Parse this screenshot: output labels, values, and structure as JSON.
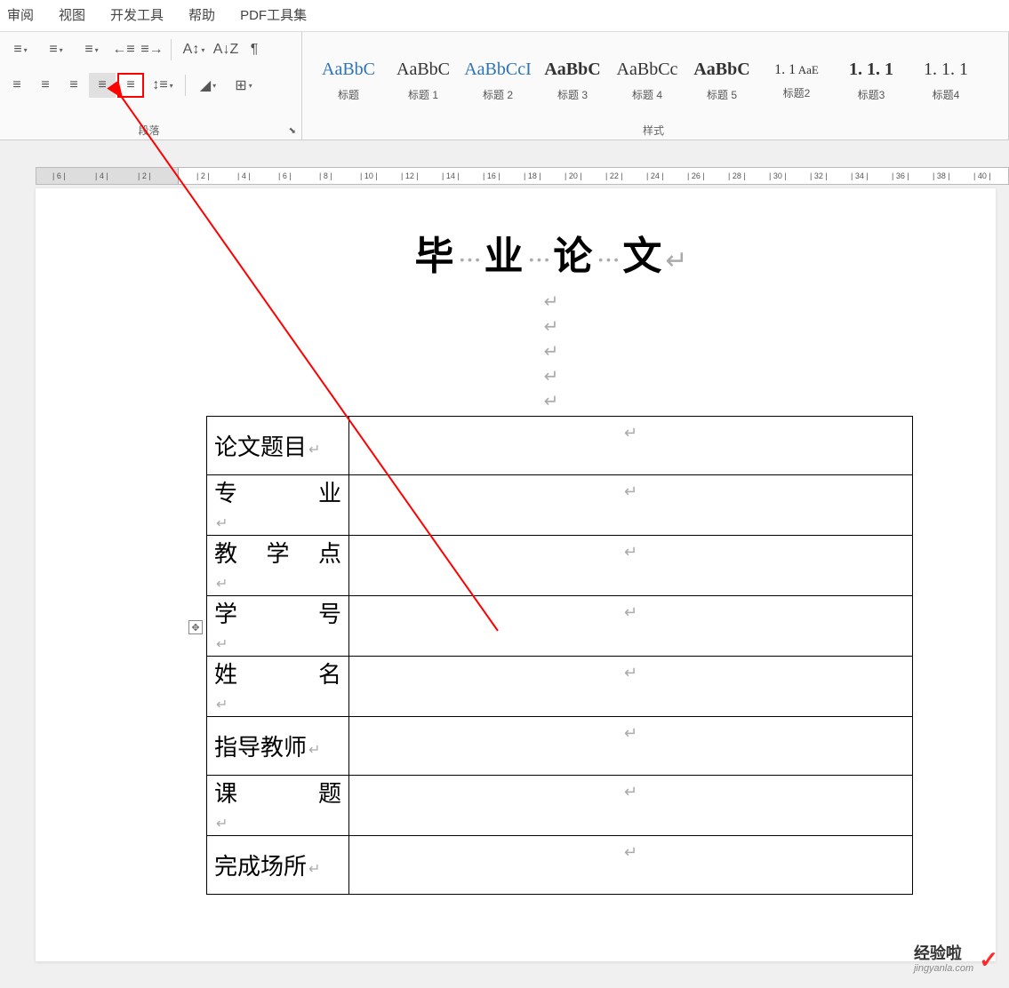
{
  "menu": {
    "items": [
      "审阅",
      "视图",
      "开发工具",
      "帮助",
      "PDF工具集"
    ]
  },
  "ribbon": {
    "paragraph": {
      "label": "段落",
      "row1": {
        "bullets": "≡",
        "numbering": "≡",
        "multilevel": "≡",
        "decrease_indent": "←≡",
        "increase_indent": "≡→",
        "char_scale": "A↕",
        "sort": "A↓Z",
        "show_marks": "¶"
      },
      "row2": {
        "align_left": "≡",
        "align_center": "≡",
        "align_right": "≡",
        "justify": "≡",
        "distribute": "≡",
        "line_spacing": "↕≡",
        "shading": "◢",
        "borders": "⊞"
      }
    },
    "styles": {
      "label": "样式",
      "items": [
        {
          "preview": "AaBbC",
          "name": "标题",
          "bold": false,
          "blue": true
        },
        {
          "preview": "AaBbC",
          "name": "标题 1",
          "bold": false,
          "blue": false
        },
        {
          "preview": "AaBbCcI",
          "name": "标题 2",
          "bold": false,
          "blue": true
        },
        {
          "preview": "AaBbC",
          "name": "标题 3",
          "bold": true,
          "blue": false
        },
        {
          "preview": "AaBbCc",
          "name": "标题 4",
          "bold": false,
          "blue": false
        },
        {
          "preview": "AaBbC",
          "name": "标题 5",
          "bold": true,
          "blue": false
        },
        {
          "preview": "1. 1",
          "name": "标题2",
          "bold": false,
          "blue": false,
          "small": true
        },
        {
          "preview": "1. 1. 1",
          "name": "标题3",
          "bold": true,
          "blue": false
        },
        {
          "preview": "1. 1. 1",
          "name": "标题4",
          "bold": false,
          "blue": false
        }
      ],
      "item_small_preview": "AaE"
    }
  },
  "ruler": {
    "neg": [
      "6",
      "4",
      "2"
    ],
    "pos": [
      "2",
      "4",
      "6",
      "8",
      "10",
      "12",
      "14",
      "16",
      "18",
      "20",
      "22",
      "24",
      "26",
      "28",
      "30",
      "32",
      "34",
      "36",
      "38",
      "40"
    ]
  },
  "document": {
    "title_chars": [
      "毕",
      "业",
      "论",
      "文"
    ],
    "table_rows": [
      {
        "label": "论文题目"
      },
      {
        "label": "专业",
        "spaced": true,
        "chars": [
          "专",
          "业"
        ]
      },
      {
        "label": "教学点",
        "spaced": true,
        "chars": [
          "教",
          "学",
          "点"
        ]
      },
      {
        "label": "学号",
        "spaced": true,
        "chars": [
          "学",
          "号"
        ]
      },
      {
        "label": "姓名",
        "spaced": true,
        "chars": [
          "姓",
          "名"
        ]
      },
      {
        "label": "指导教师"
      },
      {
        "label": "课题",
        "spaced": true,
        "chars": [
          "课",
          "题"
        ]
      },
      {
        "label": "完成场所"
      }
    ]
  },
  "watermark": {
    "cn": "经验啦",
    "en": "jingyanla.com",
    "check": "✓"
  }
}
